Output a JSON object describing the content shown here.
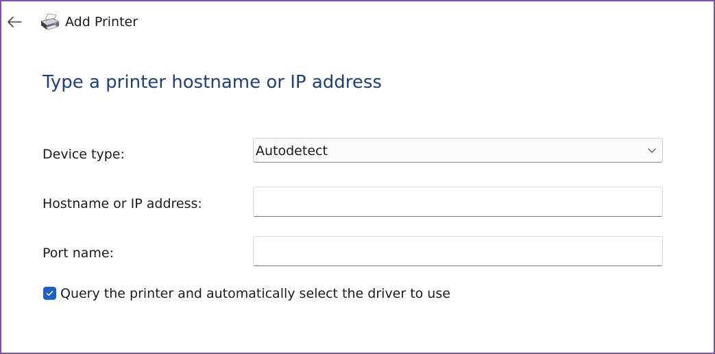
{
  "window": {
    "title": "Add Printer",
    "border_color": "#7a52a8"
  },
  "icons": {
    "back": "back-arrow-icon",
    "printer": "printer-icon",
    "chevron": "chevron-down-icon",
    "check": "checkmark-icon"
  },
  "page": {
    "heading": "Type a printer hostname or IP address",
    "heading_color": "#1f3f7a"
  },
  "form": {
    "device_type": {
      "label": "Device type:",
      "value": "Autodetect"
    },
    "hostname": {
      "label": "Hostname or IP address:",
      "value": "",
      "placeholder": ""
    },
    "port_name": {
      "label": "Port name:",
      "value": "",
      "placeholder": ""
    },
    "query_printer": {
      "label": "Query the printer and automatically select the driver to use",
      "checked": true,
      "color": "#1b62c5"
    }
  }
}
